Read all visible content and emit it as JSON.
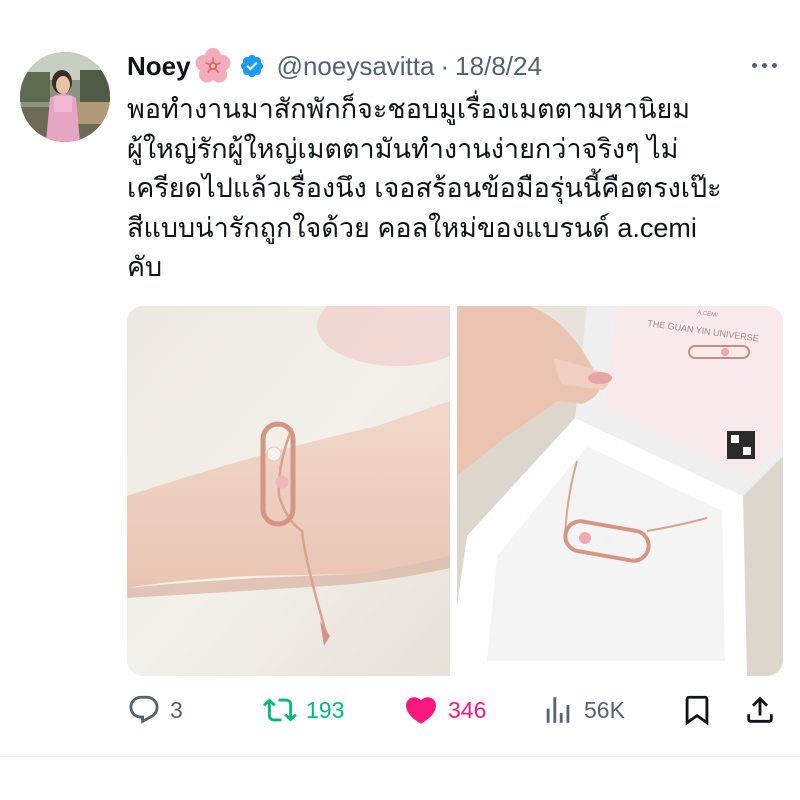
{
  "tweet": {
    "author_name": "Noey",
    "author_handle": "@noeysavitta",
    "separator": "·",
    "date": "18/8/24",
    "name_emoji_icon": "cherry-blossom-icon",
    "verified_icon": "verified-badge-icon",
    "text_lines": [
      "พอทำงานมาสักพักก็จะชอบมูเรื่องเมตตามหานิยม",
      "ผู้ใหญ่รักผู้ใหญ่เมตตามันทำงานง่ายกว่าจริงๆ ไม่",
      "เครียดไปแล้วเรื่องนึง เจอสร้อนข้อมือรุ่นนี้คือตรงเป๊ะ",
      "สีแบบน่ารักถูกใจด้วย คอลใหม่ของแบรนด์ a.cemi",
      "คับ"
    ],
    "card_text": {
      "title": "THE GUAN YIN UNIVERSE",
      "brand": "A.CEMI"
    }
  },
  "actions": {
    "reply": {
      "icon": "reply-icon",
      "count": "3",
      "color": "#536471"
    },
    "repost": {
      "icon": "repost-icon",
      "count": "193",
      "color": "#00ba7c"
    },
    "like": {
      "icon": "heart-icon",
      "count": "346",
      "color": "#f91880"
    },
    "views": {
      "icon": "views-icon",
      "count": "56K",
      "color": "#536471"
    },
    "bookmark": {
      "icon": "bookmark-icon"
    },
    "share": {
      "icon": "share-icon"
    }
  },
  "colors": {
    "text": "#0f1419",
    "secondary": "#536471",
    "verified": "#1d9bf0",
    "repost": "#00ba7c",
    "like": "#f91880"
  }
}
